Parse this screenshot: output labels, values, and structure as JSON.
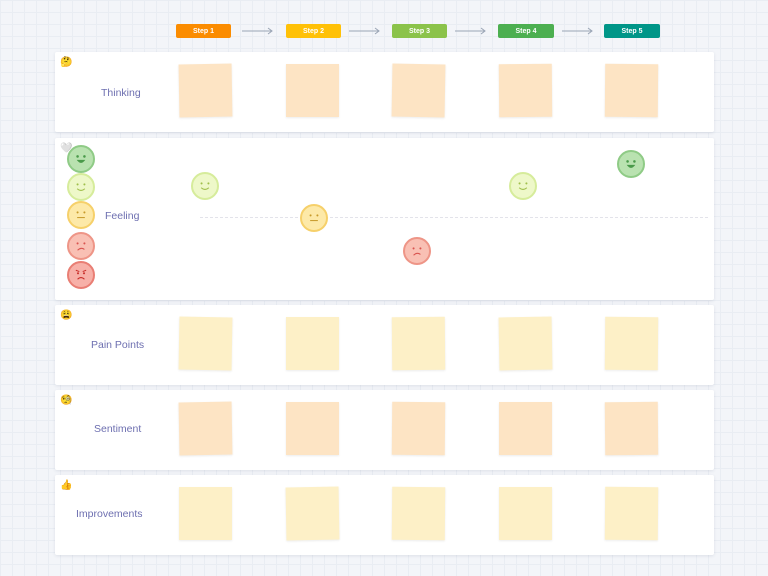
{
  "steps": [
    {
      "label": "Step 1",
      "color": "#fb8c00"
    },
    {
      "label": "Step 2",
      "color": "#ffc107"
    },
    {
      "label": "Step 3",
      "color": "#8bc34a"
    },
    {
      "label": "Step 4",
      "color": "#4caf50"
    },
    {
      "label": "Step 5",
      "color": "#009688"
    }
  ],
  "lanes": {
    "thinking": {
      "label": "Thinking",
      "emoji": "🤔",
      "sticky_color": "orange"
    },
    "feeling": {
      "label": "Feeling",
      "emoji": "🤍"
    },
    "pain_points": {
      "label": "Pain Points",
      "emoji": "😩",
      "sticky_color": "yellow"
    },
    "sentiment": {
      "label": "Sentiment",
      "emoji": "🧐",
      "sticky_color": "orange"
    },
    "improvements": {
      "label": "Improvements",
      "emoji": "👍",
      "sticky_color": "yellow"
    }
  },
  "feeling_scale": [
    "happy",
    "content",
    "neutral",
    "sad",
    "angry"
  ],
  "feeling_values": [
    {
      "step": "Step 1",
      "mood": "content"
    },
    {
      "step": "Step 2",
      "mood": "neutral"
    },
    {
      "step": "Step 3",
      "mood": "sad"
    },
    {
      "step": "Step 4",
      "mood": "content"
    },
    {
      "step": "Step 5",
      "mood": "happy"
    }
  ],
  "mood_icons": {
    "happy": "laughing-face-icon",
    "content": "smiling-face-icon",
    "neutral": "neutral-face-icon",
    "sad": "frowning-face-icon",
    "angry": "angry-face-icon"
  }
}
